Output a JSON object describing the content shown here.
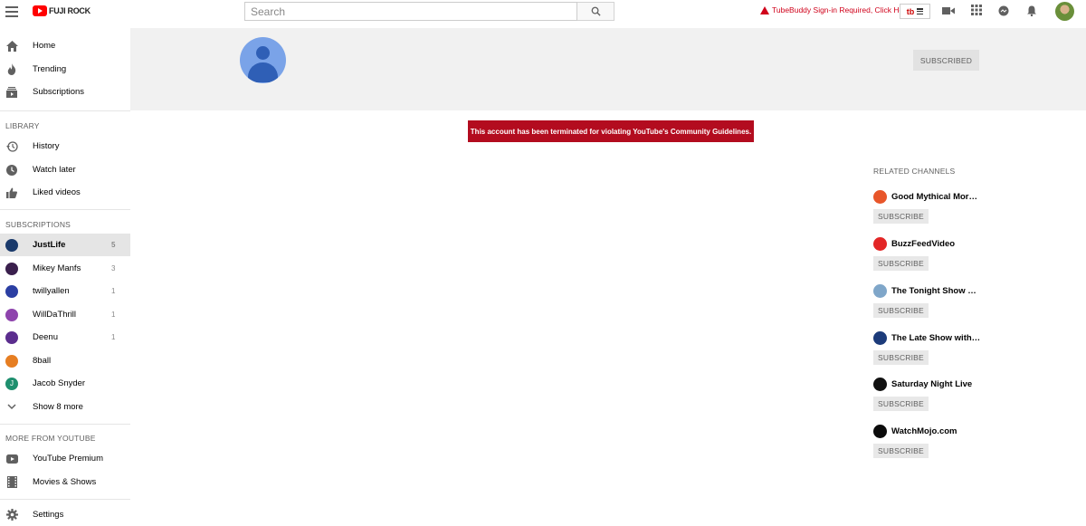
{
  "topbar": {
    "logo_text": "FUJI ROCK",
    "search_placeholder": "Search",
    "tubebuddy_warning": "TubeBuddy Sign-in Required, Click Here",
    "tubebuddy_badge": "tb"
  },
  "sidebar": {
    "main": [
      {
        "label": "Home",
        "icon": "home-icon"
      },
      {
        "label": "Trending",
        "icon": "flame-icon"
      },
      {
        "label": "Subscriptions",
        "icon": "subscriptions-icon"
      }
    ],
    "library_heading": "LIBRARY",
    "library": [
      {
        "label": "History",
        "icon": "history-icon"
      },
      {
        "label": "Watch later",
        "icon": "clock-icon"
      },
      {
        "label": "Liked videos",
        "icon": "thumbs-up-icon"
      }
    ],
    "subscriptions_heading": "SUBSCRIPTIONS",
    "subscriptions": [
      {
        "label": "JustLife",
        "count": "5",
        "color": "#1a3a6b"
      },
      {
        "label": "Mikey Manfs",
        "count": "3",
        "color": "#3a1f4d"
      },
      {
        "label": "twillyallen",
        "count": "1",
        "color": "#2b3fa3"
      },
      {
        "label": "WillDaThrill",
        "count": "1",
        "color": "#8e44ad"
      },
      {
        "label": "Deenu",
        "count": "1",
        "color": "#5b2d8e"
      },
      {
        "label": "8ball",
        "count": "",
        "color": "#e67e22"
      },
      {
        "label": "Jacob Snyder",
        "count": "",
        "color": "#1e8f6e",
        "initial": "J"
      }
    ],
    "show_more": "Show 8 more",
    "more_heading": "MORE FROM YOUTUBE",
    "more": [
      {
        "label": "YouTube Premium",
        "icon": "youtube-icon"
      },
      {
        "label": "Movies & Shows",
        "icon": "film-icon"
      }
    ],
    "settings": "Settings"
  },
  "channel": {
    "subscribed_label": "SUBSCRIBED",
    "terminated_message": "This account has been terminated for violating YouTube's Community Guidelines."
  },
  "related": {
    "title": "RELATED CHANNELS",
    "subscribe_label": "SUBSCRIBE",
    "channels": [
      {
        "name": "Good Mythical Morning",
        "color": "#e8562a"
      },
      {
        "name": "BuzzFeedVideo",
        "color": "#e32626"
      },
      {
        "name": "The Tonight Show Starring Jimmy Fallon",
        "color": "#7fa6c9"
      },
      {
        "name": "The Late Show with Stephen Colbert",
        "color": "#1c3b7a"
      },
      {
        "name": "Saturday Night Live",
        "color": "#111111"
      },
      {
        "name": "WatchMojo.com",
        "color": "#0b0b0b"
      }
    ]
  }
}
